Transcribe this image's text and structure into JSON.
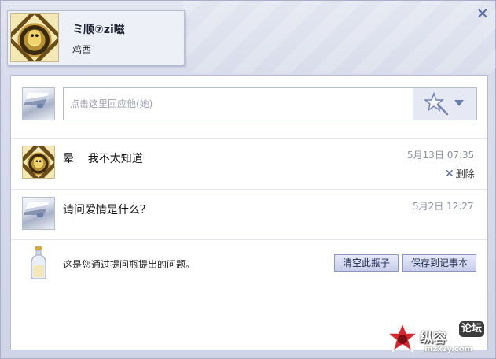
{
  "window": {
    "close_label": "✕"
  },
  "profile": {
    "name": "ミ顺⑦zi嗞",
    "subtitle": "鸡西"
  },
  "compose": {
    "placeholder": "点击这里回应他(她)"
  },
  "messages": [
    {
      "text": "晕    我不太知道",
      "time": "5月13日 07:35",
      "delete_label": "删除"
    },
    {
      "text": "请问爱情是什么？",
      "time": "5月2日 12:27"
    }
  ],
  "footer": {
    "note": "这是您通过提问瓶提出的问题。",
    "clear_button": "清空此瓶子",
    "save_button": "保存到记事本"
  },
  "watermark": {
    "brand": "纵容",
    "badge": "论坛",
    "url": "mzxzy.com"
  },
  "colors": {
    "accent": "#5a6ea8",
    "button_border": "#8b96c4"
  }
}
